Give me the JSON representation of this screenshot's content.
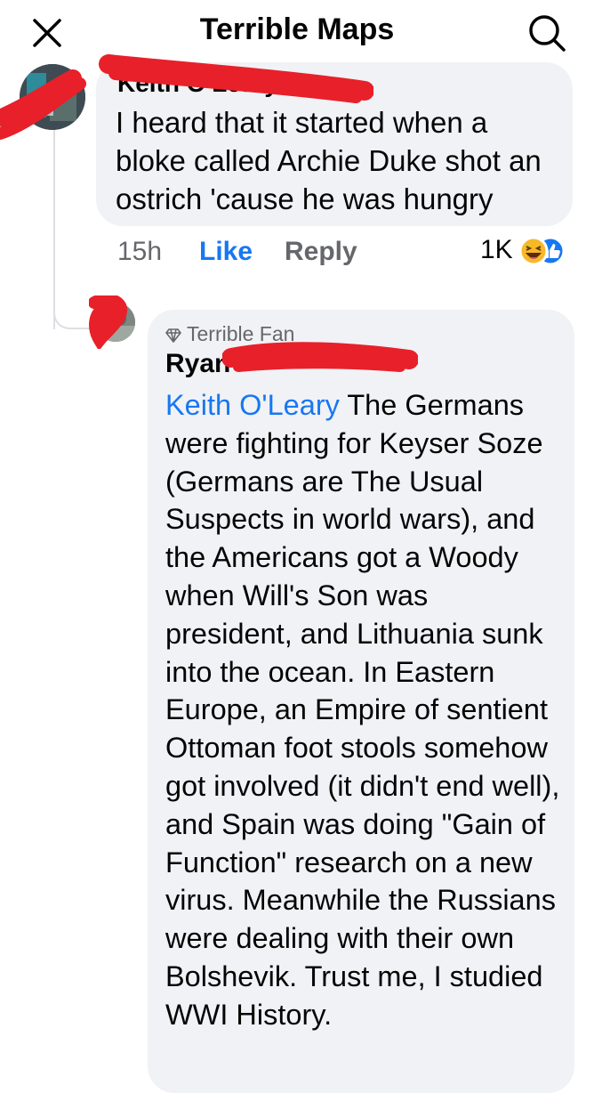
{
  "header": {
    "title": "Terrible Maps",
    "close_icon": "close-icon",
    "search_icon": "search-icon"
  },
  "comment1": {
    "author": "Keith O'Leary",
    "text": "I heard that it started when a bloke called Archie Duke shot an ostrich 'cause he was hungry",
    "time": "15h",
    "like_label": "Like",
    "reply_label": "Reply",
    "reaction_count": "1K",
    "reactions": [
      "haha-reaction",
      "like-reaction"
    ]
  },
  "comment2": {
    "badge": "Terrible Fan",
    "author": "Ryan",
    "mention": "Keith O'Leary",
    "text": " The Germans were fighting for Keyser Soze (Germans are The Usual Suspects in world wars), and the Americans got a Woody when Will's Son was president, and Lithuania sunk into the ocean. In Eastern Europe,  an Empire of sentient Ottoman foot stools somehow got involved (it didn't end well), and Spain was doing \"Gain of Function\" research on a new virus. Meanwhile the Russians were dealing with their own Bolshevik. Trust me, I studied WWI History."
  },
  "colors": {
    "link_blue": "#1877f2",
    "bubble_bg": "#f0f2f5",
    "muted_text": "#65676b",
    "redaction_red": "#e8202a"
  }
}
